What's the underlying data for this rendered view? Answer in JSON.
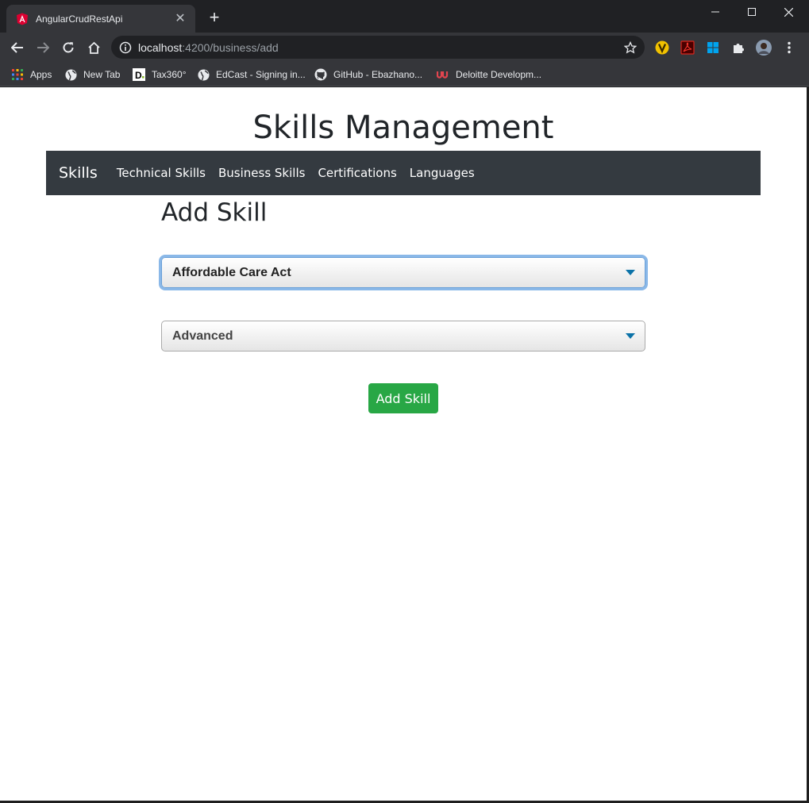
{
  "browser": {
    "tab_title": "AngularCrudRestApi",
    "url_host": "localhost",
    "url_path": ":4200/business/add",
    "bookmarks": [
      {
        "label": "Apps",
        "icon": "apps-grid-icon"
      },
      {
        "label": "New Tab",
        "icon": "globe-icon"
      },
      {
        "label": "Tax360°",
        "icon": "d-logo-icon"
      },
      {
        "label": "EdCast - Signing in...",
        "icon": "globe-icon"
      },
      {
        "label": "GitHub - Ebazhano...",
        "icon": "github-icon"
      },
      {
        "label": "Deloitte Developm...",
        "icon": "udemy-icon"
      }
    ],
    "extensions": [
      "vimium-icon",
      "pdf-icon",
      "windows-icon",
      "puzzle-icon",
      "profile-avatar"
    ]
  },
  "page": {
    "title": "Skills Management",
    "navbar": {
      "brand": "Skills",
      "links": [
        "Technical Skills",
        "Business Skills",
        "Certifications",
        "Languages"
      ]
    },
    "heading": "Add Skill",
    "skill_select": {
      "value": "Affordable Care Act"
    },
    "level_select": {
      "value": "Advanced"
    },
    "submit_label": "Add Skill"
  },
  "colors": {
    "navbar_bg": "#343a40",
    "button_green": "#28a745",
    "focus_ring": "#8ab8e8",
    "chrome_dark": "#202124",
    "chrome_toolbar": "#35363a"
  }
}
